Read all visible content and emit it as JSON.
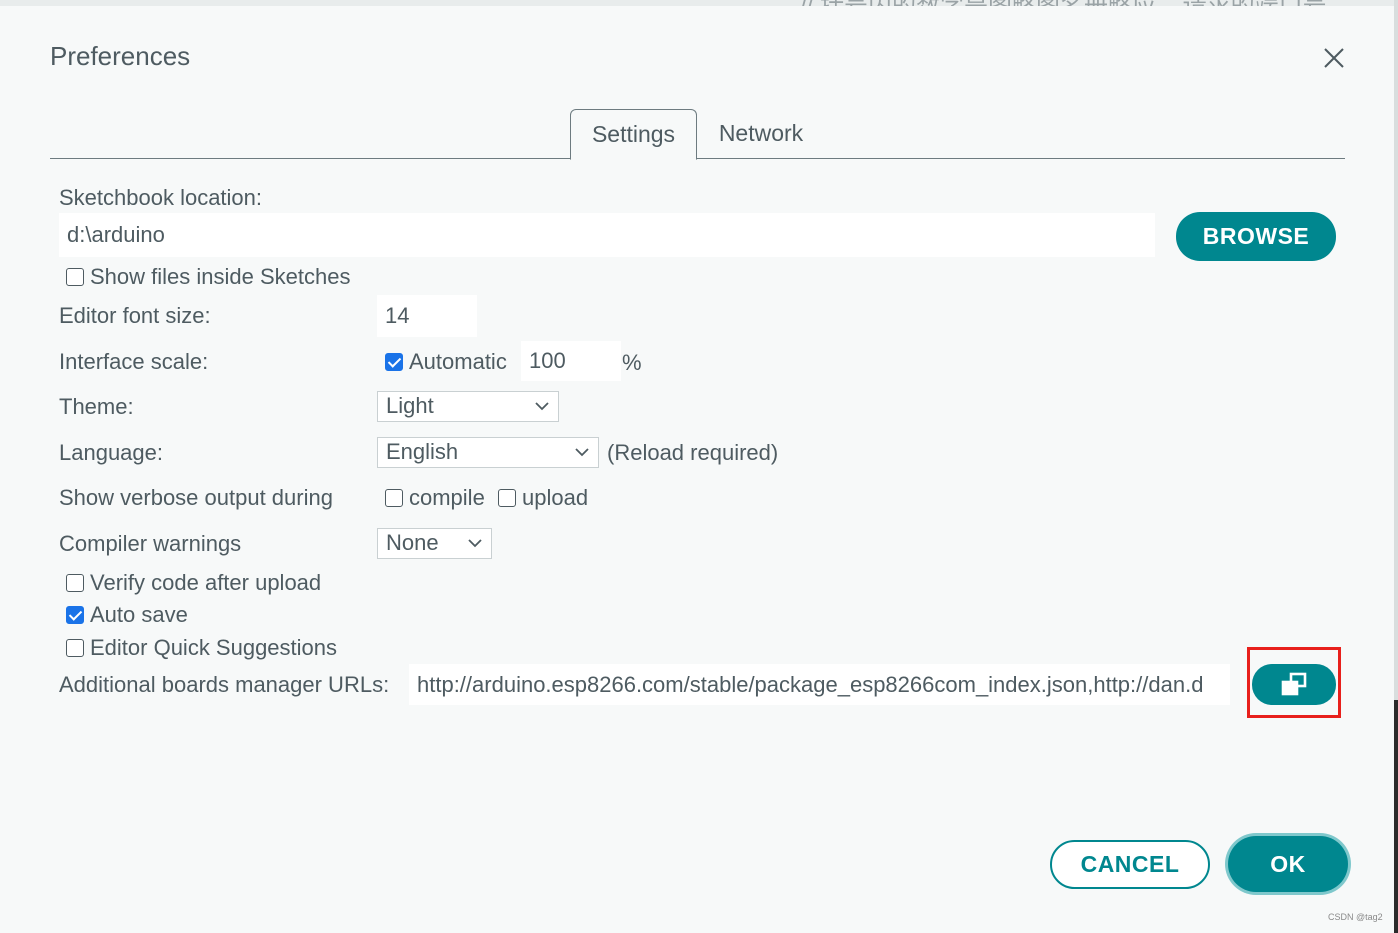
{
  "backdrop": {
    "code_comment": "// 括号内的数字是图略图名册略应... 请求的端口号"
  },
  "dialog": {
    "title": "Preferences",
    "tabs": [
      {
        "label": "Settings",
        "active": true
      },
      {
        "label": "Network",
        "active": false
      }
    ],
    "sketchbook": {
      "label": "Sketchbook location:",
      "value": "d:\\arduino",
      "browse_label": "BROWSE",
      "show_files_label": "Show files inside Sketches",
      "show_files_checked": false
    },
    "font_size": {
      "label": "Editor font size:",
      "value": "14"
    },
    "interface_scale": {
      "label": "Interface scale:",
      "automatic_label": "Automatic",
      "automatic_checked": true,
      "value": "100",
      "unit": "%"
    },
    "theme": {
      "label": "Theme:",
      "selected": "Light"
    },
    "language": {
      "label": "Language:",
      "selected": "English",
      "note": "(Reload required)"
    },
    "verbose": {
      "label": "Show verbose output during",
      "compile_label": "compile",
      "compile_checked": false,
      "upload_label": "upload",
      "upload_checked": false
    },
    "compiler_warnings": {
      "label": "Compiler warnings",
      "selected": "None"
    },
    "verify_code": {
      "label": "Verify code after upload",
      "checked": false
    },
    "auto_save": {
      "label": "Auto save",
      "checked": true
    },
    "quick_suggestions": {
      "label": "Editor Quick Suggestions",
      "checked": false
    },
    "boards_urls": {
      "label": "Additional boards manager URLs:",
      "value": "http://arduino.esp8266.com/stable/package_esp8266com_index.json,http://dan.d"
    },
    "cancel_label": "CANCEL",
    "ok_label": "OK"
  },
  "watermark": "CSDN @tag2",
  "colors": {
    "accent": "#00878f",
    "checkbox": "#1a73e8",
    "highlight": "#e8201c",
    "text": "#4e5b61"
  },
  "icons": [
    "close-icon",
    "checkmark-icon",
    "chevron-down-icon",
    "open-window-icon"
  ]
}
